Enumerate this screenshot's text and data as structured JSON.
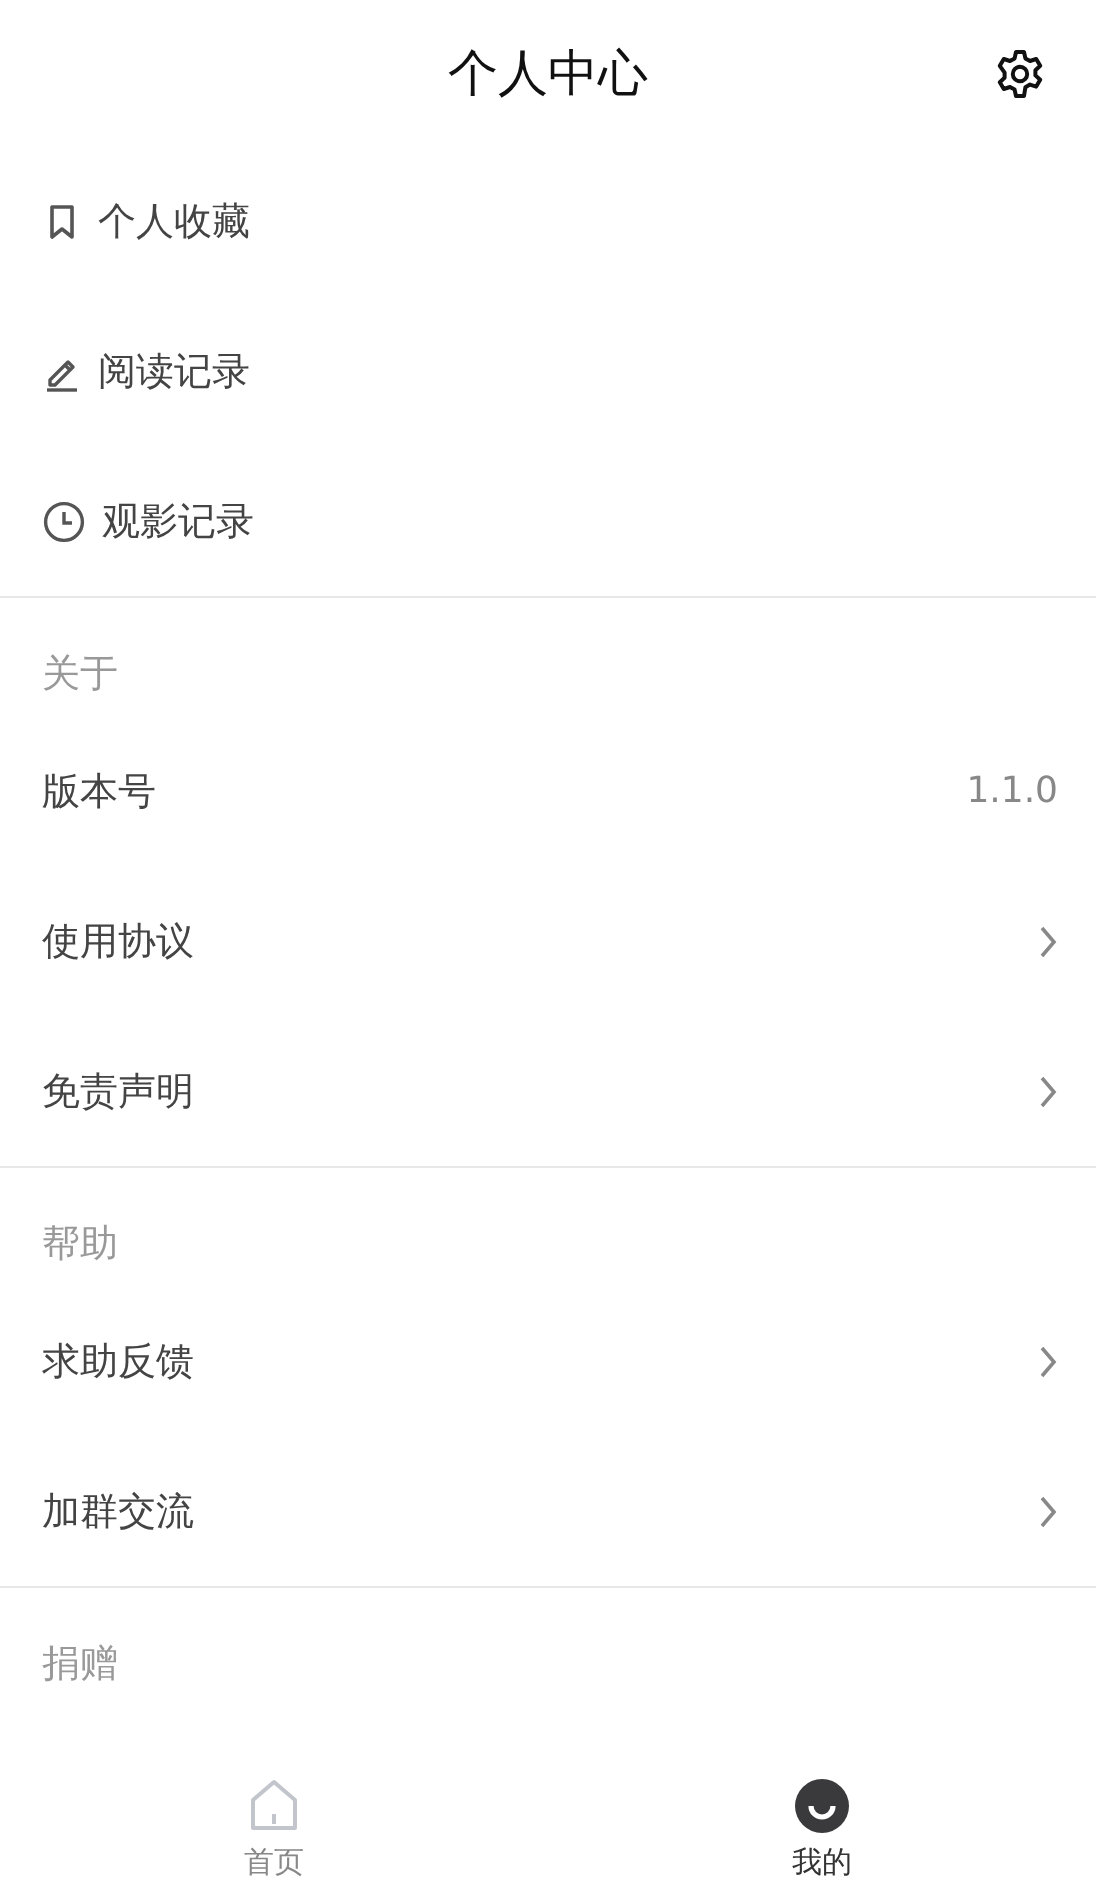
{
  "header": {
    "title": "个人中心"
  },
  "shortcuts": [
    {
      "label": "个人收藏",
      "kind": "bookmark"
    },
    {
      "label": "阅读记录",
      "kind": "pencil"
    },
    {
      "label": "观影记录",
      "kind": "clock"
    }
  ],
  "sections": [
    {
      "title": "关于",
      "rows": [
        {
          "label": "版本号",
          "kind": "value",
          "value": "1.1.0"
        },
        {
          "label": "使用协议",
          "kind": "link"
        },
        {
          "label": "免责声明",
          "kind": "link"
        }
      ]
    },
    {
      "title": "帮助",
      "rows": [
        {
          "label": "求助反馈",
          "kind": "link"
        },
        {
          "label": "加群交流",
          "kind": "link"
        }
      ]
    },
    {
      "title": "捐赠"
    }
  ],
  "tabs": [
    {
      "label": "首页",
      "kind": "home",
      "selected": false
    },
    {
      "label": "我的",
      "kind": "smile",
      "selected": true
    }
  ]
}
